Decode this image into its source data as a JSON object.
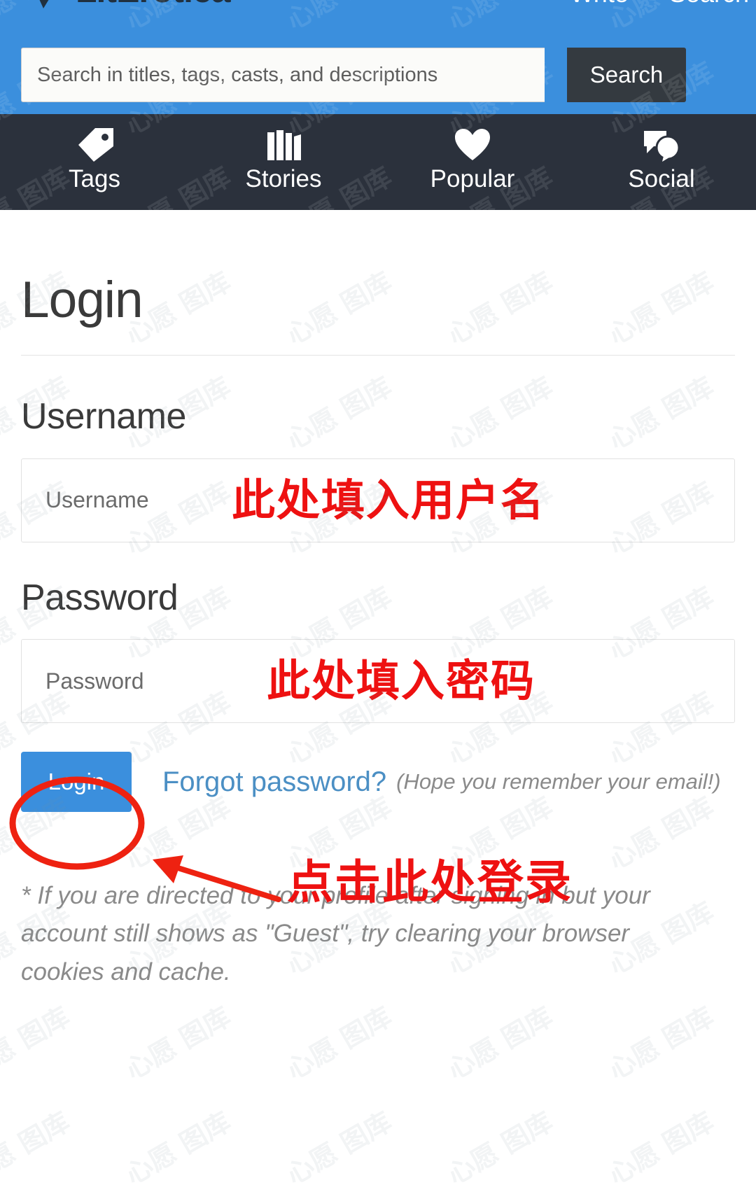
{
  "header": {
    "logo_text": "LitErotica",
    "links": [
      {
        "label": "Write",
        "name": "header-link-write"
      },
      {
        "label": "Search",
        "name": "header-link-search"
      }
    ],
    "search": {
      "placeholder": "Search in titles, tags, casts, and descriptions",
      "value": "",
      "button_label": "Search"
    }
  },
  "navbar": {
    "items": [
      {
        "label": "Tags",
        "icon": "tag-icon"
      },
      {
        "label": "Stories",
        "icon": "books-icon"
      },
      {
        "label": "Popular",
        "icon": "heart-icon"
      },
      {
        "label": "Social",
        "icon": "speech-bubbles-icon"
      }
    ]
  },
  "login": {
    "page_title": "Login",
    "username_label": "Username",
    "username_placeholder": "Username",
    "username_value": "",
    "password_label": "Password",
    "password_placeholder": "Password",
    "password_value": "",
    "login_button": "Login",
    "forgot_link": "Forgot password?",
    "forgot_note": "(Hope you remember your email!)",
    "footnote": "* If you are directed to your profile after signing in but your account still shows as \"Guest\", try clearing your browser cookies and cache."
  },
  "annotations": {
    "username_hint": "此处填入用户名",
    "password_hint": "此处填入密码",
    "login_hint": "点击此处登录",
    "color": "#ee1111"
  },
  "colors": {
    "header_blue": "#3b8fdd",
    "nav_dark": "#2b313c",
    "search_button": "#343a40",
    "link_blue": "#4b8fc4",
    "text_dark": "#3a3a3a",
    "muted": "#8a8a8a",
    "annotation_red": "#ee1111"
  },
  "watermark": {
    "text": "心愿 图库"
  }
}
